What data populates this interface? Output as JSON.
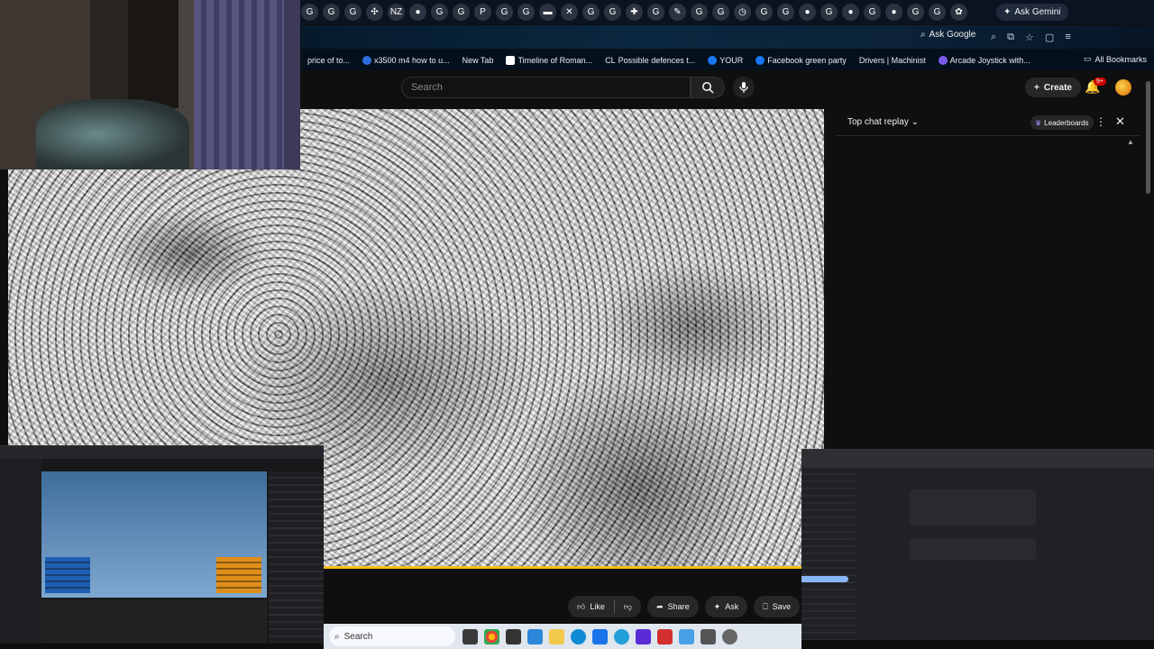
{
  "browser": {
    "tab_favicons": [
      "G",
      "G",
      "G",
      "✣",
      "NZ",
      "●",
      "G",
      "G",
      "P",
      "G",
      "G",
      "▬",
      "✕",
      "G",
      "G",
      "✚",
      "G",
      "✎",
      "G",
      "G",
      "◷",
      "G",
      "G",
      "●",
      "G",
      "●",
      "G",
      "●",
      "G",
      "G",
      "✿"
    ],
    "ask_gemini_label": "Ask Gemini",
    "ask_google_label": "Ask Google",
    "bookmarks": [
      "price of to...",
      "x3500 m4 how to u...",
      "New Tab",
      "Timeline of Roman...",
      "Possible defences t...",
      "YOUR",
      "Facebook green party",
      "Drivers | Machinist",
      "Arcade Joystick with..."
    ],
    "all_bookmarks_label": "All Bookmarks"
  },
  "youtube": {
    "search_placeholder": "Search",
    "create_label": "Create",
    "notif_count": "9+",
    "chat": {
      "title": "Top chat replay",
      "leaderboards_label": "Leaderboards"
    },
    "actions": {
      "like_label": "Like",
      "share_label": "Share",
      "ask_label": "Ask",
      "save_label": "Save"
    }
  },
  "taskbar": {
    "search_label": "Search"
  },
  "colors": {
    "progress": "#f7c11a",
    "background": "#0f0f0f",
    "notif_badge": "#cc0000"
  }
}
